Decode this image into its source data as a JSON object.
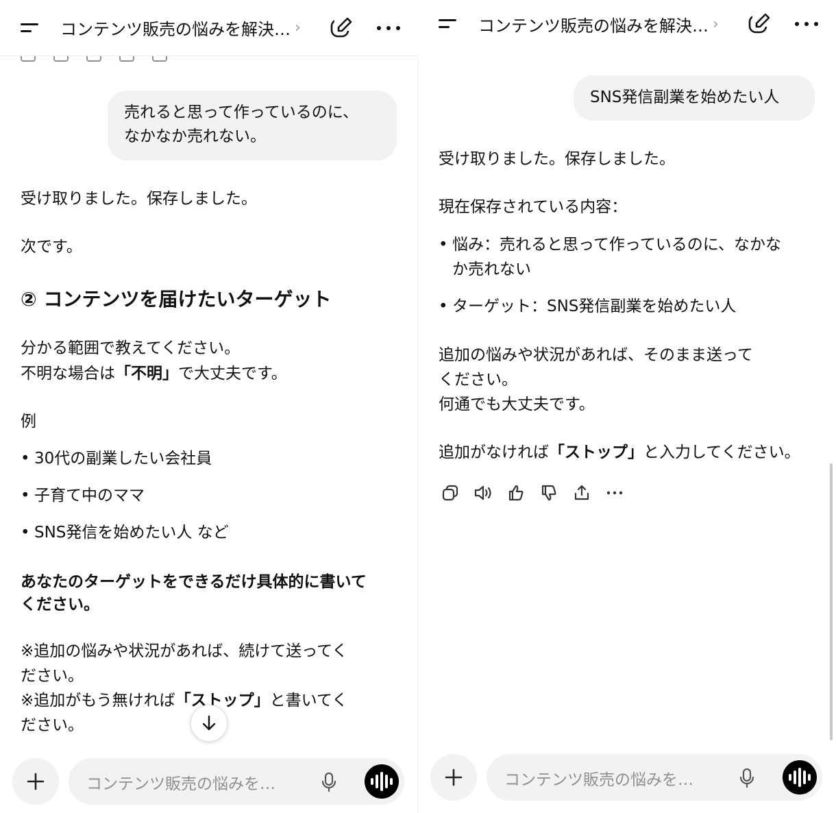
{
  "left": {
    "header": {
      "title": "コンテンツ販売の悩みを解決…",
      "chevron": "›"
    },
    "user_message": {
      "lines": [
        "売れると思って作っているのに、",
        "なかなか売れない。"
      ]
    },
    "assistant": {
      "received": "受け取りました。保存しました。",
      "next": "次です。",
      "heading": "② コンテンツを届けたいターゲット",
      "instruction_line1": "分かる範囲で教えてください。",
      "instruction_line2_pre": "不明な場合は",
      "instruction_line2_bold": "「不明」",
      "instruction_line2_post": "で大丈夫です。",
      "example_label": "例",
      "examples": [
        "30代の副業したい会社員",
        "子育て中のママ",
        "SNS発信を始めたい人 など"
      ],
      "request_line1": "あなたのターゲットをできるだけ具体的に書いて",
      "request_line2": "ください。",
      "note1_line1": "※追加の悩みや状況があれば、続けて送ってく",
      "note1_line2": "ださい。",
      "note2_pre": "※追加がもう無ければ",
      "note2_bold": "「ストップ」",
      "note2_post": "と書いてく",
      "note2_line2": "ださい。"
    },
    "composer": {
      "placeholder": "コンテンツ販売の悩みを…"
    }
  },
  "right": {
    "header": {
      "title": "コンテンツ販売の悩みを解決…",
      "chevron": "›"
    },
    "user_message": {
      "text": "SNS発信副業を始めたい人"
    },
    "assistant": {
      "received": "受け取りました。保存しました。",
      "saved_label": "現在保存されている内容：",
      "saved_items": [
        {
          "line1": "悩み：売れると思って作っているのに、なかな",
          "line2": "か売れない"
        },
        {
          "line1": "ターゲット：SNS発信副業を始めたい人",
          "line2": ""
        }
      ],
      "more_line1": "追加の悩みや状況があれば、そのまま送って",
      "more_line2": "ください。",
      "more_line3": "何通でも大丈夫です。",
      "stop_pre": "追加がなければ",
      "stop_bold": "「ストップ」",
      "stop_post": "と入力してください。"
    },
    "actions": [
      "copy-icon",
      "speaker-icon",
      "thumbs-up-icon",
      "thumbs-down-icon",
      "share-icon",
      "more-icon"
    ],
    "composer": {
      "placeholder": "コンテンツ販売の悩みを…"
    }
  },
  "bullet_glyph": "•",
  "colors": {
    "bubble": "#f2f2f2",
    "text": "#0d0d0d",
    "muted": "#8f8f8f",
    "voice": "#000000"
  }
}
